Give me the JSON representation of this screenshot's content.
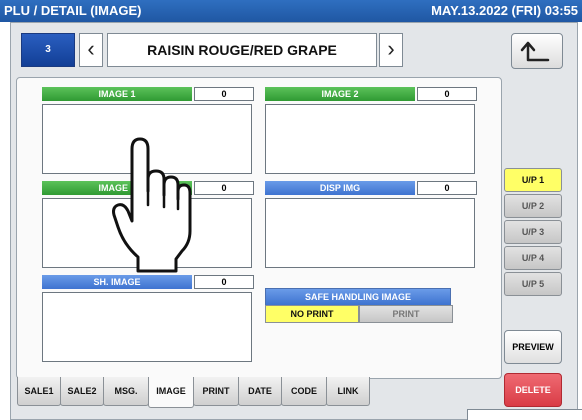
{
  "title": "PLU / DETAIL (IMAGE)",
  "datetime": "MAY.13.2022 (FRI) 03:55",
  "nav": {
    "plu_number": "3",
    "prev_icon": "chevron-left-icon",
    "next_icon": "chevron-right-icon",
    "item_name": "RAISIN ROUGE/RED GRAPE",
    "back_icon": "return-arrow-icon"
  },
  "slots": {
    "image1": {
      "label": "IMAGE 1",
      "value": "0"
    },
    "image2": {
      "label": "IMAGE 2",
      "value": "0"
    },
    "image3": {
      "label": "IMAGE 3",
      "value": "0"
    },
    "disp_img": {
      "label": "DISP IMG",
      "value": "0"
    },
    "sh_image": {
      "label": "SH. IMAGE",
      "value": "0"
    }
  },
  "safe_handling": {
    "label": "SAFE HANDLING IMAGE",
    "options": [
      "NO PRINT",
      "PRINT"
    ],
    "selected": "NO PRINT"
  },
  "up_buttons": [
    "U/P 1",
    "U/P 2",
    "U/P 3",
    "U/P 4",
    "U/P 5"
  ],
  "up_active": "U/P 1",
  "preview_label": "PREVIEW",
  "delete_label": "DELETE",
  "tabs": [
    "SALE1",
    "SALE2",
    "MSG.",
    "IMAGE",
    "PRINT",
    "DATE",
    "CODE",
    "LINK"
  ],
  "active_tab": "IMAGE",
  "colors": {
    "title_bar": "#1f57a3",
    "green_header": "#3aa33c",
    "blue_header": "#4f82dc",
    "active_up": "#ffff66",
    "delete": "#d93c46"
  },
  "overlay_icon": "hand-pointer-icon"
}
